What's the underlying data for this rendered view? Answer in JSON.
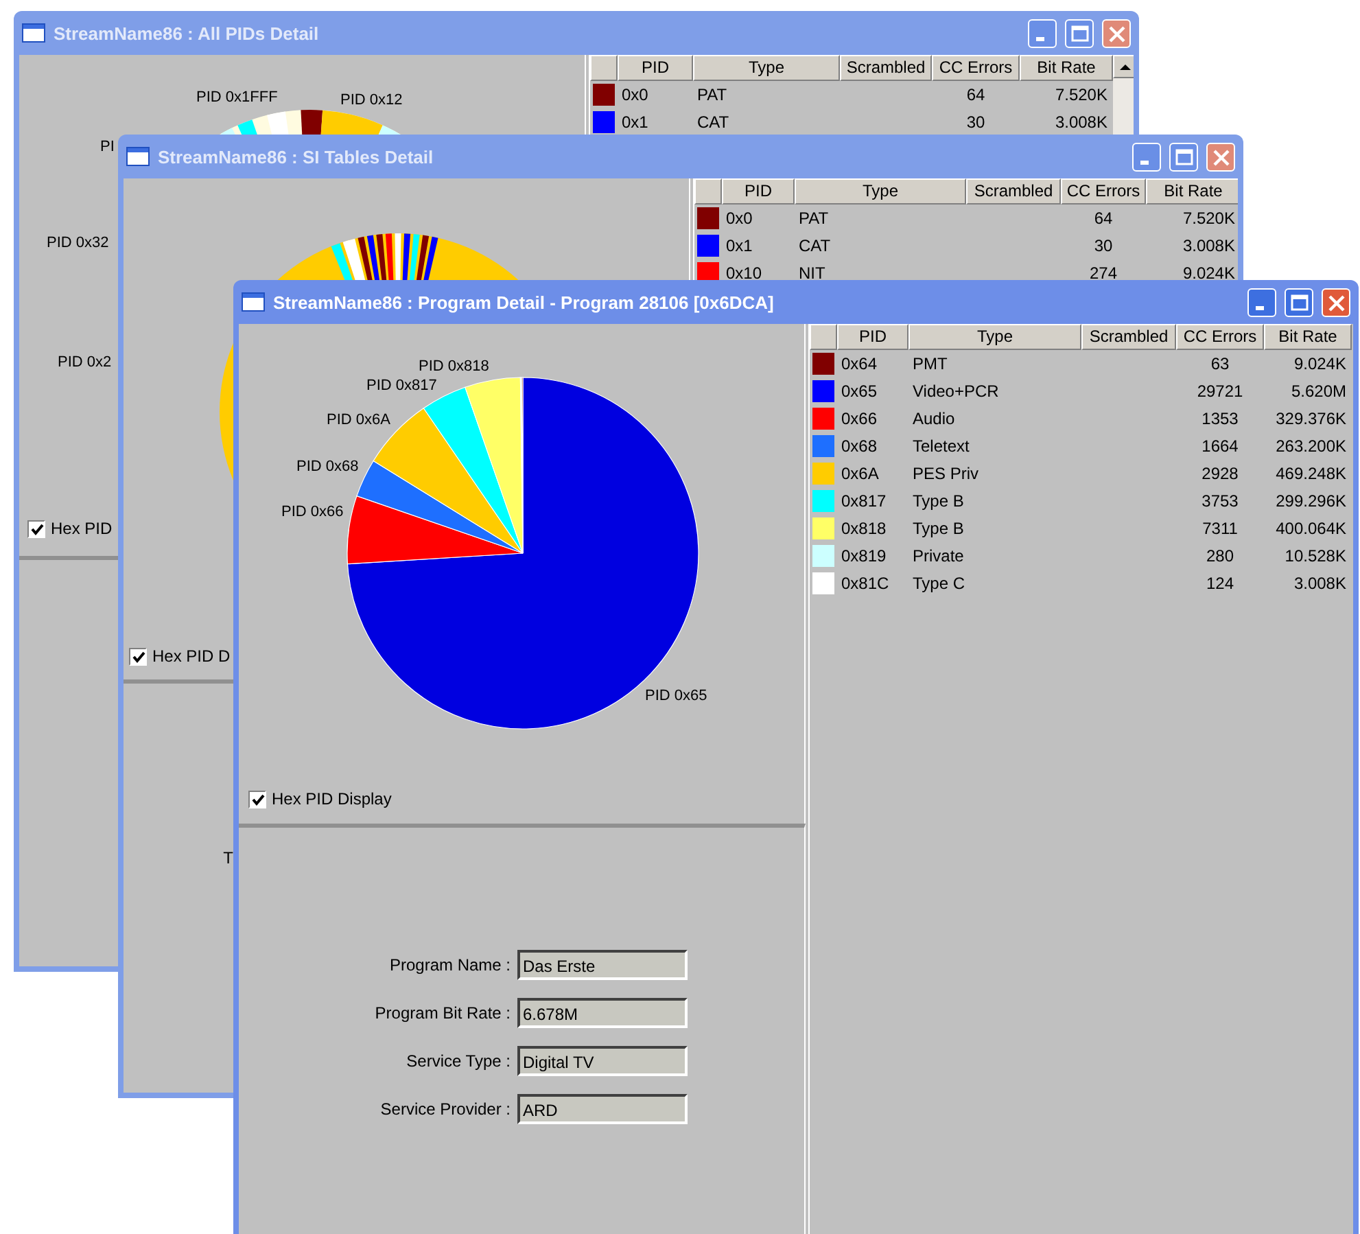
{
  "windows": [
    {
      "title": "StreamName86 : All PIDs Detail",
      "active": false,
      "scrollbar": true,
      "pie_labels": [
        "PID 0x1FFF",
        "PID 0x12",
        "PI",
        "PID 0x32",
        "PID 0x2"
      ],
      "checkbox": {
        "label": "Hex PID",
        "checked": true
      },
      "table": {
        "columns": [
          "PID",
          "Type",
          "Scrambled",
          "CC Errors",
          "Bit Rate"
        ],
        "rows": [
          {
            "color": "#800000",
            "pid": "0x0",
            "type": "PAT",
            "cc_errors": "64",
            "bit_rate": "7.520K"
          },
          {
            "color": "#0000ff",
            "pid": "0x1",
            "type": "CAT",
            "cc_errors": "30",
            "bit_rate": "3.008K"
          }
        ]
      }
    },
    {
      "title": "StreamName86 : SI Tables Detail",
      "active": false,
      "checkbox": {
        "label": "Hex PID D",
        "checked": true
      },
      "table": {
        "columns": [
          "PID",
          "Type",
          "Scrambled",
          "CC Errors",
          "Bit Rate"
        ],
        "rows": [
          {
            "color": "#800000",
            "pid": "0x0",
            "type": "PAT",
            "cc_errors": "64",
            "bit_rate": "7.520K"
          },
          {
            "color": "#0000ff",
            "pid": "0x1",
            "type": "CAT",
            "cc_errors": "30",
            "bit_rate": "3.008K"
          },
          {
            "color": "#ff0000",
            "pid": "0x10",
            "type": "NIT",
            "cc_errors": "274",
            "bit_rate": "9.024K"
          }
        ]
      },
      "info_fields": [
        {
          "label": "T"
        }
      ]
    },
    {
      "title": "StreamName86 : Program Detail - Program 28106 [0x6DCA]",
      "active": true,
      "pie_labels": [
        "PID 0x818",
        "PID 0x817",
        "PID 0x6A",
        "PID 0x68",
        "PID 0x66",
        "PID 0x65"
      ],
      "checkbox": {
        "label": "Hex PID Display",
        "checked": true
      },
      "table": {
        "columns": [
          "PID",
          "Type",
          "Scrambled",
          "CC Errors",
          "Bit Rate"
        ],
        "rows": [
          {
            "color": "#800000",
            "pid": "0x64",
            "type": "PMT",
            "cc_errors": "63",
            "bit_rate": "9.024K"
          },
          {
            "color": "#0000ff",
            "pid": "0x65",
            "type": "Video+PCR",
            "cc_errors": "29721",
            "bit_rate": "5.620M"
          },
          {
            "color": "#ff0000",
            "pid": "0x66",
            "type": "Audio",
            "cc_errors": "1353",
            "bit_rate": "329.376K"
          },
          {
            "color": "#1e6fff",
            "pid": "0x68",
            "type": "Teletext",
            "cc_errors": "1664",
            "bit_rate": "263.200K"
          },
          {
            "color": "#ffcc00",
            "pid": "0x6A",
            "type": "PES Priv",
            "cc_errors": "2928",
            "bit_rate": "469.248K"
          },
          {
            "color": "#00ffff",
            "pid": "0x817",
            "type": "Type B",
            "cc_errors": "3753",
            "bit_rate": "299.296K"
          },
          {
            "color": "#ffff66",
            "pid": "0x818",
            "type": "Type B",
            "cc_errors": "7311",
            "bit_rate": "400.064K"
          },
          {
            "color": "#ccffff",
            "pid": "0x819",
            "type": "Private",
            "cc_errors": "280",
            "bit_rate": "10.528K"
          },
          {
            "color": "#ffffff",
            "pid": "0x81C",
            "type": "Type C",
            "cc_errors": "124",
            "bit_rate": "3.008K"
          }
        ]
      },
      "info_fields": [
        {
          "label": "Program Name :",
          "value": "Das Erste"
        },
        {
          "label": "Program Bit Rate :",
          "value": "6.678M"
        },
        {
          "label": "Service Type :",
          "value": "Digital TV"
        },
        {
          "label": "Service Provider :",
          "value": "ARD"
        }
      ]
    }
  ]
}
